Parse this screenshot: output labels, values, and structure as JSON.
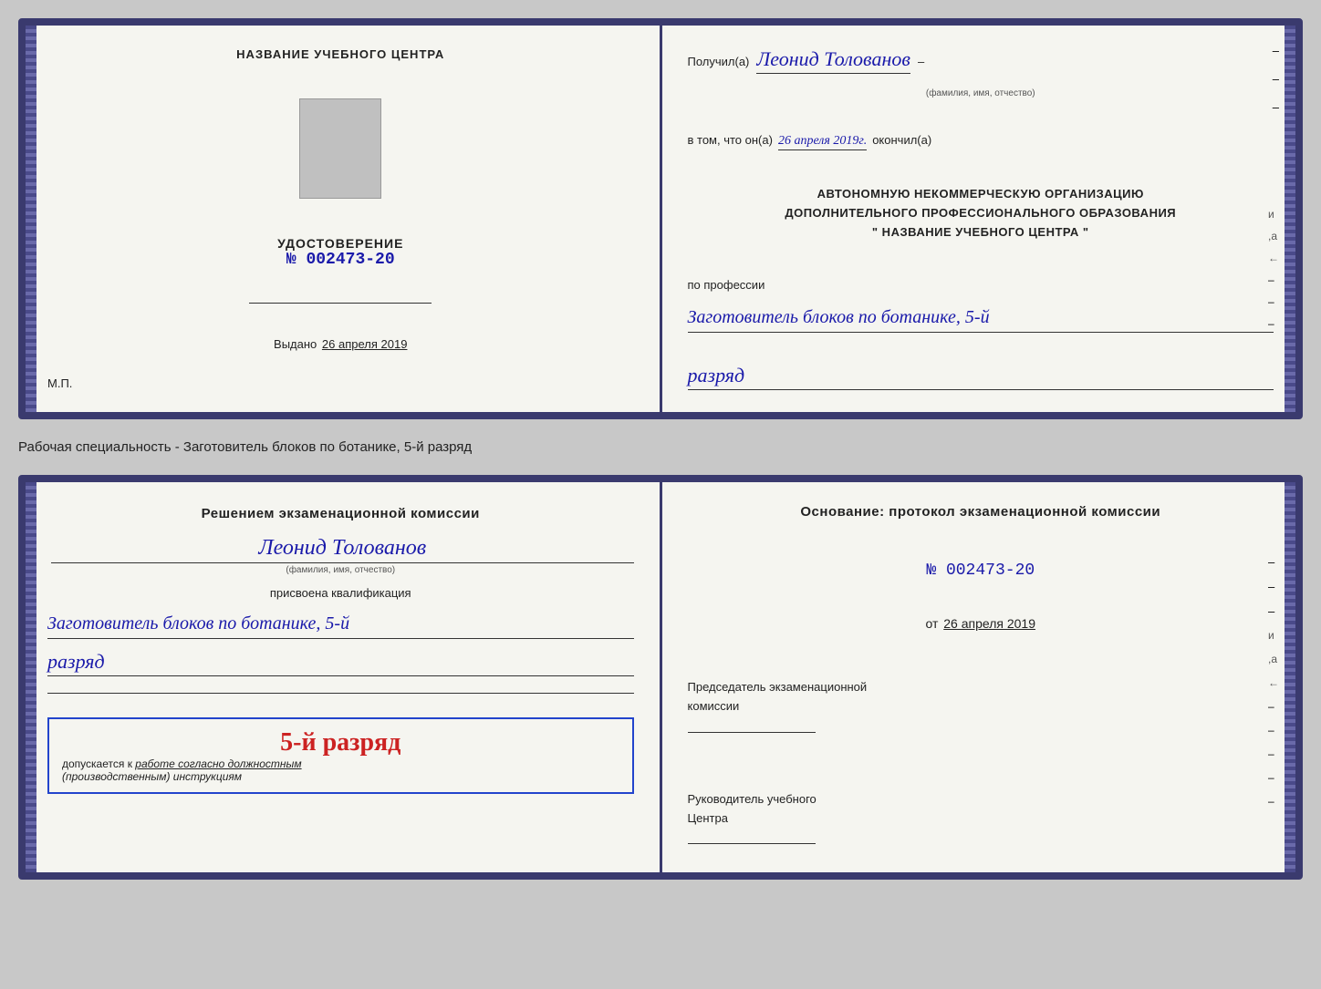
{
  "page": {
    "background_color": "#c8c8c8"
  },
  "top_cert": {
    "left": {
      "org_name_title": "НАЗВАНИЕ УЧЕБНОГО ЦЕНТРА",
      "udostoverenie_title": "УДОСТОВЕРЕНИЕ",
      "cert_number_prefix": "№",
      "cert_number": "002473-20",
      "vydano_label": "Выдано",
      "vydano_date": "26 апреля 2019",
      "mp": "М.П."
    },
    "right": {
      "poluchil_label": "Получил(а)",
      "recipient_name": "Леонид Толованов",
      "fio_subtitle": "(фамилия, имя, отчество)",
      "dash": "–",
      "vtom_label": "в том, что он(а)",
      "completed_date": "26 апреля 2019г.",
      "okончил_label": "окончил(а)",
      "autocert_line1": "АВТОНОМНУЮ НЕКОММЕРЧЕСКУЮ ОРГАНИЗАЦИЮ",
      "autocert_line2": "ДОПОЛНИТЕЛЬНОГО ПРОФЕССИОНАЛЬНОГО ОБРАЗОВАНИЯ",
      "autocert_line3": "\"   НАЗВАНИЕ УЧЕБНОГО ЦЕНТРА   \"",
      "po_professii_label": "по профессии",
      "profession": "Заготовитель блоков по ботанике, 5-й",
      "razryad": "разряд"
    }
  },
  "specialty_line": "Рабочая специальность - Заготовитель блоков по ботанике, 5-й разряд",
  "bottom_cert": {
    "left": {
      "resheniem_title": "Решением экзаменационной комиссии",
      "recipient_name": "Леонид Толованов",
      "fio_subtitle": "(фамилия, имя, отчество)",
      "prisvoena_label": "присвоена квалификация",
      "qualification": "Заготовитель блоков по ботанике, 5-й",
      "razryad": "разряд",
      "stamp_text": "5-й разряд",
      "dopuskaetsya": "допускается к",
      "rabote_label": "работе согласно должностным",
      "instruktsiyam": "(производственным) инструкциям"
    },
    "right": {
      "osnovanie_label": "Основание: протокол экзаменационной комиссии",
      "number_prefix": "№",
      "protokol_number": "002473-20",
      "ot_prefix": "от",
      "ot_date": "26 апреля 2019",
      "predsedatel_label": "Председатель экзаменационной",
      "komissii_label": "комиссии",
      "rukovoditel_label": "Руководитель учебного",
      "tsentra_label": "Центра"
    }
  }
}
